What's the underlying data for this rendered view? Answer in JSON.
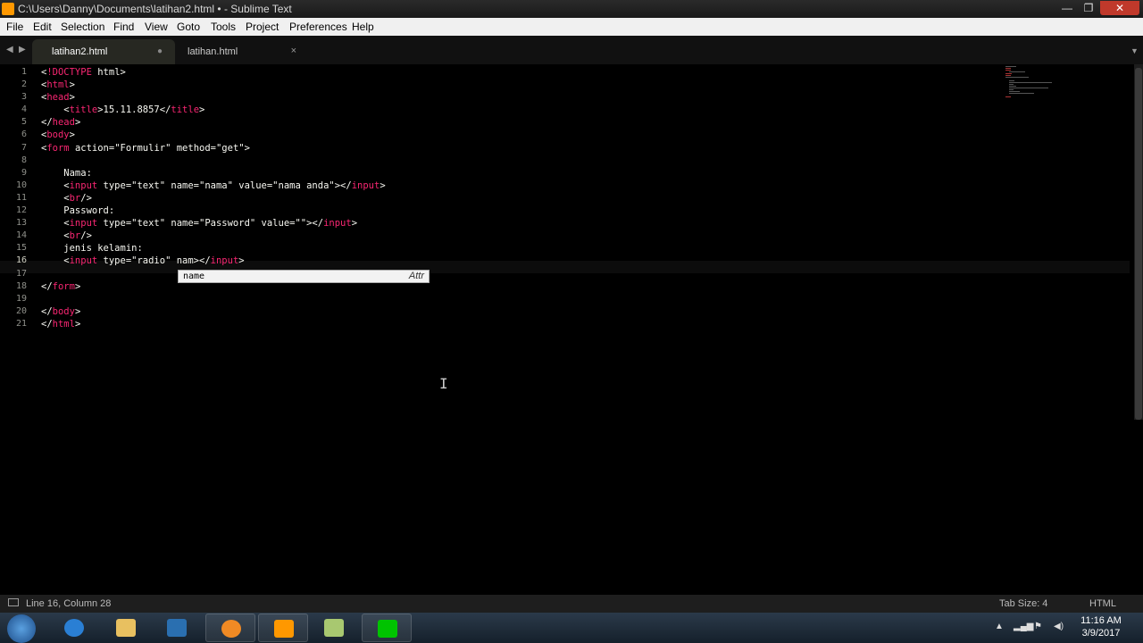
{
  "window": {
    "title": "C:\\Users\\Danny\\Documents\\latihan2.html • - Sublime Text",
    "min": "—",
    "max": "❐",
    "close": "✕"
  },
  "menu": [
    "File",
    "Edit",
    "Selection",
    "Find",
    "View",
    "Goto",
    "Tools",
    "Project",
    "Preferences",
    "Help"
  ],
  "tabs": [
    {
      "label": "latihan2.html",
      "active": true,
      "marker": "●"
    },
    {
      "label": "latihan.html",
      "active": false,
      "marker": "×"
    }
  ],
  "editor": {
    "line_numbers": [
      "1",
      "2",
      "3",
      "4",
      "5",
      "6",
      "7",
      "8",
      "9",
      "10",
      "11",
      "12",
      "13",
      "14",
      "15",
      "16",
      "17",
      "18",
      "19",
      "20",
      "21"
    ],
    "current_line": 16
  },
  "autocomplete": {
    "word": "name",
    "kind": "Attr"
  },
  "status": {
    "position": "Line 16, Column 28",
    "tab_size": "Tab Size: 4",
    "syntax": "HTML"
  },
  "clock": {
    "time": "11:16 AM",
    "date": "3/9/2017"
  },
  "icons": {
    "taskbar": [
      "internet-explorer-icon",
      "file-explorer-icon",
      "media-player-icon",
      "sublime-text-icon",
      "notepad-icon",
      "line-app-icon"
    ]
  }
}
